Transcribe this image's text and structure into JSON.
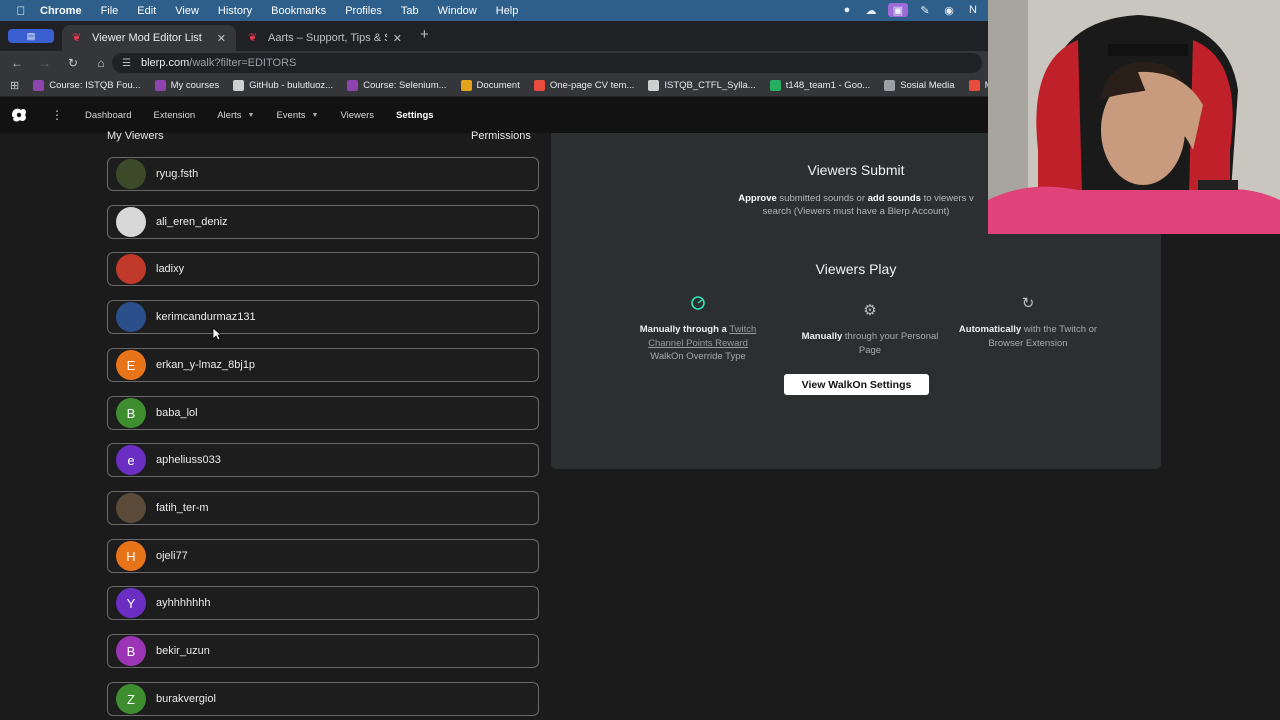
{
  "menubar": {
    "app": "Chrome",
    "items": [
      "File",
      "Edit",
      "View",
      "History",
      "Bookmarks",
      "Profiles",
      "Tab",
      "Window",
      "Help"
    ]
  },
  "tabs": [
    {
      "title": "Viewer Mod Editor List",
      "active": true
    },
    {
      "title": "Aarts – Support, Tips & Soun",
      "active": false
    }
  ],
  "address": {
    "host": "blerp.com",
    "path": "/walk?filter=EDITORS"
  },
  "bookmarks": [
    {
      "label": "Course: ISTQB Fou...",
      "color": "#8e44ad"
    },
    {
      "label": "My courses",
      "color": "#8e44ad"
    },
    {
      "label": "GitHub - bulutluoz...",
      "color": "#cfcfcf"
    },
    {
      "label": "Course: Selenium...",
      "color": "#8e44ad"
    },
    {
      "label": "Document",
      "color": "#e3a21a"
    },
    {
      "label": "One-page CV tem...",
      "color": "#e74c3c"
    },
    {
      "label": "ISTQB_CTFL_Sylla...",
      "color": "#cfcfcf"
    },
    {
      "label": "t148_team1 - Goo...",
      "color": "#27ae60"
    },
    {
      "label": "Sosial Media",
      "color": "#9aa0a6"
    },
    {
      "label": "M",
      "color": "#e74c3c"
    }
  ],
  "appnav": {
    "items": [
      {
        "label": "Dashboard",
        "dropdown": false,
        "active": false
      },
      {
        "label": "Extension",
        "dropdown": false,
        "active": false
      },
      {
        "label": "Alerts",
        "dropdown": true,
        "active": false
      },
      {
        "label": "Events",
        "dropdown": true,
        "active": false
      },
      {
        "label": "Viewers",
        "dropdown": false,
        "active": false
      },
      {
        "label": "Settings",
        "dropdown": false,
        "active": true
      }
    ]
  },
  "viewers_section": {
    "title": "My Viewers",
    "permissions_label": "Permissions",
    "items": [
      {
        "name": "ryug.fsth",
        "initial": "",
        "avatar_color": "#3d4a2a"
      },
      {
        "name": "ali_eren_deniz",
        "initial": "",
        "avatar_color": "#d8d8d8"
      },
      {
        "name": "ladixy",
        "initial": "",
        "avatar_color": "#c0392b"
      },
      {
        "name": "kerimcandurmaz131",
        "initial": "",
        "avatar_color": "#2b4f8a"
      },
      {
        "name": "erkan_y-lmaz_8bj1p",
        "initial": "E",
        "avatar_color": "#e8741a"
      },
      {
        "name": "baba_lol",
        "initial": "B",
        "avatar_color": "#3e8e2f"
      },
      {
        "name": "apheliuss033",
        "initial": "e",
        "avatar_color": "#6a2fc2"
      },
      {
        "name": "fatih_ter-m",
        "initial": "",
        "avatar_color": "#5a4a3a"
      },
      {
        "name": "ojeli77",
        "initial": "H",
        "avatar_color": "#e8741a"
      },
      {
        "name": "ayhhhhhhh",
        "initial": "Y",
        "avatar_color": "#6a2fc2"
      },
      {
        "name": "bekir_uzun",
        "initial": "B",
        "avatar_color": "#9b35b5"
      },
      {
        "name": "burakvergiol",
        "initial": "Z",
        "avatar_color": "#3e8e2f"
      }
    ]
  },
  "panel": {
    "submit_title": "Viewers Submit",
    "submit_desc_1": "Approve",
    "submit_desc_2": " submitted sounds or ",
    "submit_desc_3": "add sounds",
    "submit_desc_4": " to viewers v",
    "submit_desc_5": "search (Viewers must have a Blerp Account)",
    "play_title": "Viewers Play",
    "options": [
      {
        "bold": "Manually through a",
        "link": "Twitch Channel Points Reward",
        "rest": "WalkOn Override Type",
        "icon": "spinner-icon",
        "icon_color": "#2fe3b8"
      },
      {
        "bold": "Manually",
        "link": "",
        "rest": " through your Personal Page",
        "icon": "gear-icon",
        "icon_color": "#bdbdbd"
      },
      {
        "bold": "Automatically",
        "link": "",
        "rest": " with the Twitch or Browser Extension",
        "icon": "sync-icon",
        "icon_color": "#bdbdbd"
      }
    ],
    "walkon_button": "View WalkOn Settings"
  },
  "colors": {
    "accent_teal": "#2fe3b8",
    "page_bg": "#1b1b1b",
    "panel_bg": "#2c2f30"
  }
}
